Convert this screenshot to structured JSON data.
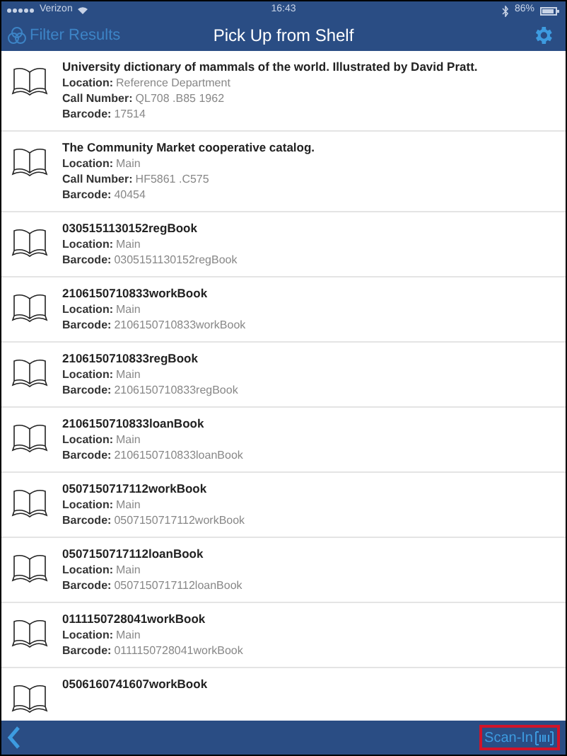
{
  "status_bar": {
    "carrier": "Verizon",
    "time": "16:43",
    "battery": "86%"
  },
  "nav_bar": {
    "filter": "Filter Results",
    "title": "Pick Up from Shelf"
  },
  "items": [
    {
      "title": "University dictionary of mammals of the world. Illustrated by David Pratt.",
      "fields": [
        {
          "label": "Location:",
          "value": "Reference Department"
        },
        {
          "label": "Call Number:",
          "value": "QL708 .B85 1962"
        },
        {
          "label": "Barcode:",
          "value": "17514"
        }
      ]
    },
    {
      "title": "The Community Market cooperative catalog.",
      "fields": [
        {
          "label": "Location:",
          "value": "Main"
        },
        {
          "label": "Call Number:",
          "value": "HF5861 .C575"
        },
        {
          "label": "Barcode:",
          "value": "40454"
        }
      ]
    },
    {
      "title": "0305151130152regBook",
      "fields": [
        {
          "label": "Location:",
          "value": "Main"
        },
        {
          "label": "Barcode:",
          "value": "0305151130152regBook"
        }
      ]
    },
    {
      "title": "2106150710833workBook",
      "fields": [
        {
          "label": "Location:",
          "value": "Main"
        },
        {
          "label": "Barcode:",
          "value": "2106150710833workBook"
        }
      ]
    },
    {
      "title": "2106150710833regBook",
      "fields": [
        {
          "label": "Location:",
          "value": "Main"
        },
        {
          "label": "Barcode:",
          "value": "2106150710833regBook"
        }
      ]
    },
    {
      "title": "2106150710833loanBook",
      "fields": [
        {
          "label": "Location:",
          "value": "Main"
        },
        {
          "label": "Barcode:",
          "value": "2106150710833loanBook"
        }
      ]
    },
    {
      "title": "0507150717112workBook",
      "fields": [
        {
          "label": "Location:",
          "value": "Main"
        },
        {
          "label": "Barcode:",
          "value": "0507150717112workBook"
        }
      ]
    },
    {
      "title": "0507150717112loanBook",
      "fields": [
        {
          "label": "Location:",
          "value": "Main"
        },
        {
          "label": "Barcode:",
          "value": "0507150717112loanBook"
        }
      ]
    },
    {
      "title": "0111150728041workBook",
      "fields": [
        {
          "label": "Location:",
          "value": "Main"
        },
        {
          "label": "Barcode:",
          "value": "0111150728041workBook"
        }
      ]
    },
    {
      "title": "0506160741607workBook"
    }
  ],
  "bottom_bar": {
    "scan": "Scan-In"
  }
}
